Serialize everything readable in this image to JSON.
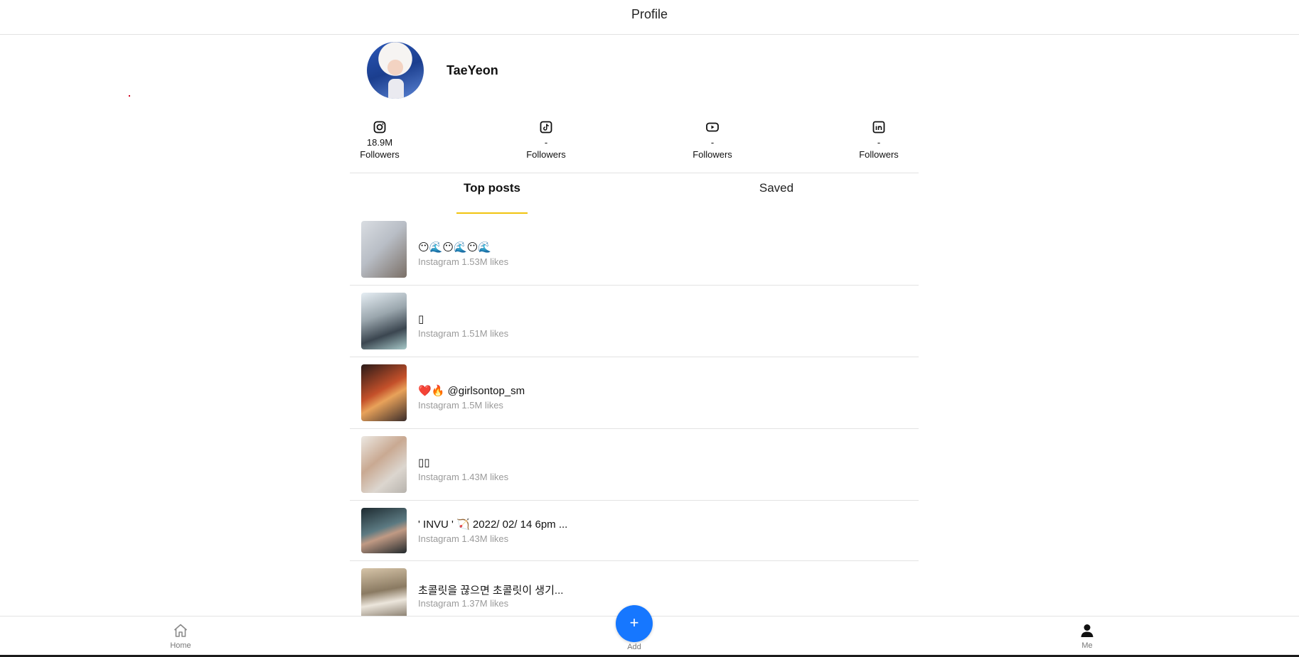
{
  "header": {
    "title": "Profile"
  },
  "profile": {
    "name": "TaeYeon"
  },
  "socials": [
    {
      "platform": "instagram-icon",
      "count": "18.9M",
      "label": "Followers"
    },
    {
      "platform": "tiktok-icon",
      "count": "-",
      "label": "Followers"
    },
    {
      "platform": "youtube-icon",
      "count": "-",
      "label": "Followers"
    },
    {
      "platform": "linkedin-icon",
      "count": "-",
      "label": "Followers"
    }
  ],
  "tabs": [
    {
      "label": "Top posts",
      "active": true
    },
    {
      "label": "Saved",
      "active": false
    }
  ],
  "posts": [
    {
      "caption": "😶🌊😶🌊😶🌊",
      "meta": "Instagram 1.53M likes"
    },
    {
      "caption": "▯",
      "meta": "Instagram 1.51M likes"
    },
    {
      "caption": "❤️🔥 @girlsontop_sm",
      "meta": "Instagram 1.5M likes"
    },
    {
      "caption": "▯▯",
      "meta": "Instagram 1.43M likes"
    },
    {
      "caption": "' INVU ' 🏹 2022/ 02/ 14 6pm ...",
      "meta": "Instagram 1.43M likes"
    },
    {
      "caption": "초콜릿을 끊으면 초콜릿이 생기...",
      "meta": "Instagram 1.37M likes"
    }
  ],
  "nav": {
    "home_label": "Home",
    "add_symbol": "+",
    "add_label": "Add",
    "me_label": "Me"
  },
  "colors": {
    "accent": "#1677ff",
    "tab_indicator": "#f1c40f",
    "meta_text": "#9a9a9a"
  }
}
